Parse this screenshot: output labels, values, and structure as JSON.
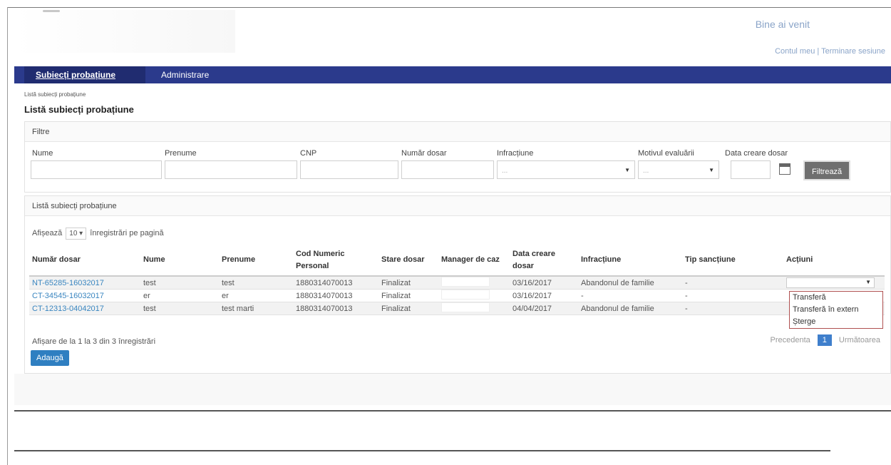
{
  "header": {
    "welcome": "Bine ai venit",
    "my_account": "Contul meu",
    "separator": " | ",
    "logout": "Terminare sesiune"
  },
  "nav": {
    "tabs": [
      {
        "label": "Subiecți probațiune",
        "active": true
      },
      {
        "label": "Administrare",
        "active": false
      }
    ]
  },
  "breadcrumb": "Listă subiecți probațiune",
  "page_title": "Listă subiecți probațiune",
  "filters": {
    "panel_title": "Filtre",
    "labels": {
      "name": "Nume",
      "first_name": "Prenume",
      "cnp": "CNP",
      "file_number": "Număr dosar",
      "offense": "Infracțiune",
      "reason": "Motivul evaluării",
      "created_date": "Data creare dosar"
    },
    "offense_placeholder": "...",
    "reason_placeholder": "...",
    "filter_button": "Filtrează"
  },
  "list": {
    "panel_title": "Listă subiecți probațiune",
    "show_prefix": "Afișează",
    "page_size": "10",
    "show_suffix": "înregistrări pe pagină",
    "columns": [
      "Număr dosar",
      "Nume",
      "Prenume",
      "Cod Numeric Personal",
      "Stare dosar",
      "Manager de caz",
      "Data creare dosar",
      "Infracțiune",
      "Tip sancțiune",
      "Acțiuni"
    ],
    "rows": [
      {
        "file": "NT-65285-16032017",
        "name": "test",
        "first_name": "test",
        "cnp": "1880314070013",
        "status": "Finalizat",
        "manager": "",
        "date": "03/16/2017",
        "offense": "Abandonul de familie",
        "sanction": "-"
      },
      {
        "file": "CT-34545-16032017",
        "name": "er",
        "first_name": "er",
        "cnp": "1880314070013",
        "status": "Finalizat",
        "manager": "",
        "date": "03/16/2017",
        "offense": "-",
        "sanction": "-"
      },
      {
        "file": "CT-12313-04042017",
        "name": "test",
        "first_name": "test marti",
        "cnp": "1880314070013",
        "status": "Finalizat",
        "manager": "",
        "date": "04/04/2017",
        "offense": "Abandonul de familie",
        "sanction": "-"
      }
    ],
    "actions_menu": [
      "Transferă",
      "Transferă în extern",
      "Șterge"
    ],
    "info": "Afișare de la 1 la 3 din 3 înregistrări",
    "add_button": "Adaugă",
    "pager": {
      "prev": "Precedenta",
      "current": "1",
      "next": "Următoarea"
    }
  }
}
